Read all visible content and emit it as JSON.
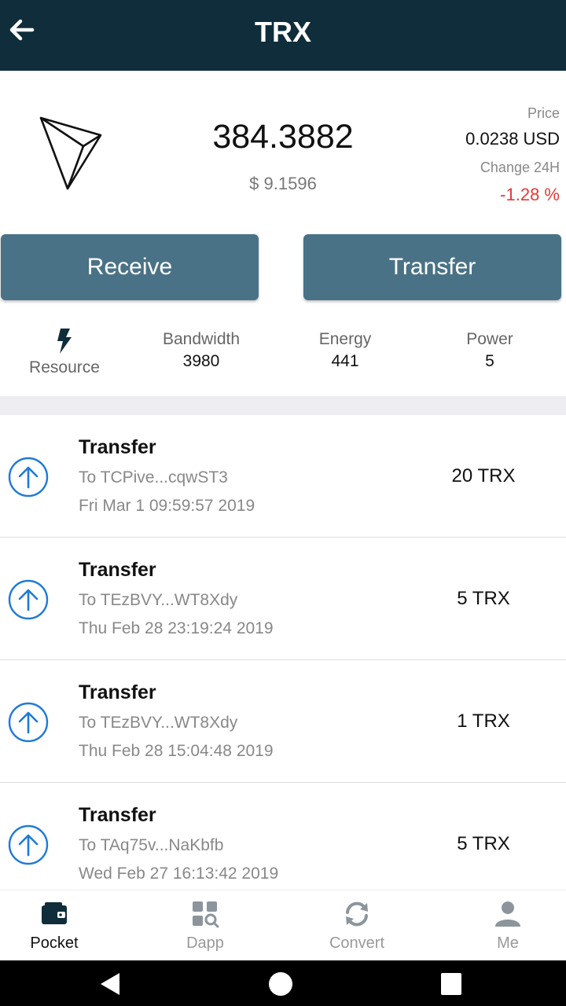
{
  "appbar": {
    "title": "TRX",
    "back_icon": "arrow-left-icon"
  },
  "summary": {
    "logo_icon": "tron-logo-icon",
    "balance": "384.3882",
    "fiat_value": "$ 9.1596",
    "price_label": "Price",
    "price_value": "0.0238 USD",
    "change_label": "Change 24H",
    "change_value": "-1.28 %",
    "change_color": "#e53935"
  },
  "actions": {
    "receive_label": "Receive",
    "transfer_label": "Transfer",
    "button_color": "#4a7286"
  },
  "resources": {
    "main_label": "Resource",
    "main_icon": "lightning-bolt-icon",
    "items": [
      {
        "label": "Bandwidth",
        "value": "3980"
      },
      {
        "label": "Energy",
        "value": "441"
      },
      {
        "label": "Power",
        "value": "5"
      }
    ]
  },
  "transactions": [
    {
      "type": "Transfer",
      "to": "To TCPive...cqwST3",
      "date": "Fri Mar  1 09:59:57 2019",
      "amount": "20 TRX",
      "icon": "arrow-up-circle-icon"
    },
    {
      "type": "Transfer",
      "to": "To TEzBVY...WT8Xdy",
      "date": "Thu Feb 28 23:19:24 2019",
      "amount": "5 TRX",
      "icon": "arrow-up-circle-icon"
    },
    {
      "type": "Transfer",
      "to": "To TEzBVY...WT8Xdy",
      "date": "Thu Feb 28 15:04:48 2019",
      "amount": "1 TRX",
      "icon": "arrow-up-circle-icon"
    },
    {
      "type": "Transfer",
      "to": "To TAq75v...NaKbfb",
      "date": "Wed Feb 27 16:13:42 2019",
      "amount": "5 TRX",
      "icon": "arrow-up-circle-icon"
    }
  ],
  "nav": {
    "items": [
      {
        "label": "Pocket",
        "icon": "wallet-icon",
        "active": true
      },
      {
        "label": "Dapp",
        "icon": "dapp-grid-icon",
        "active": false
      },
      {
        "label": "Convert",
        "icon": "convert-arrows-icon",
        "active": false
      },
      {
        "label": "Me",
        "icon": "person-icon",
        "active": false
      }
    ]
  },
  "system_nav": {
    "back_icon": "triangle-back-icon",
    "home_icon": "circle-home-icon",
    "recents_icon": "square-recents-icon"
  },
  "colors": {
    "appbar": "#0f2d3a",
    "accent_blue": "#1f7ad6"
  }
}
